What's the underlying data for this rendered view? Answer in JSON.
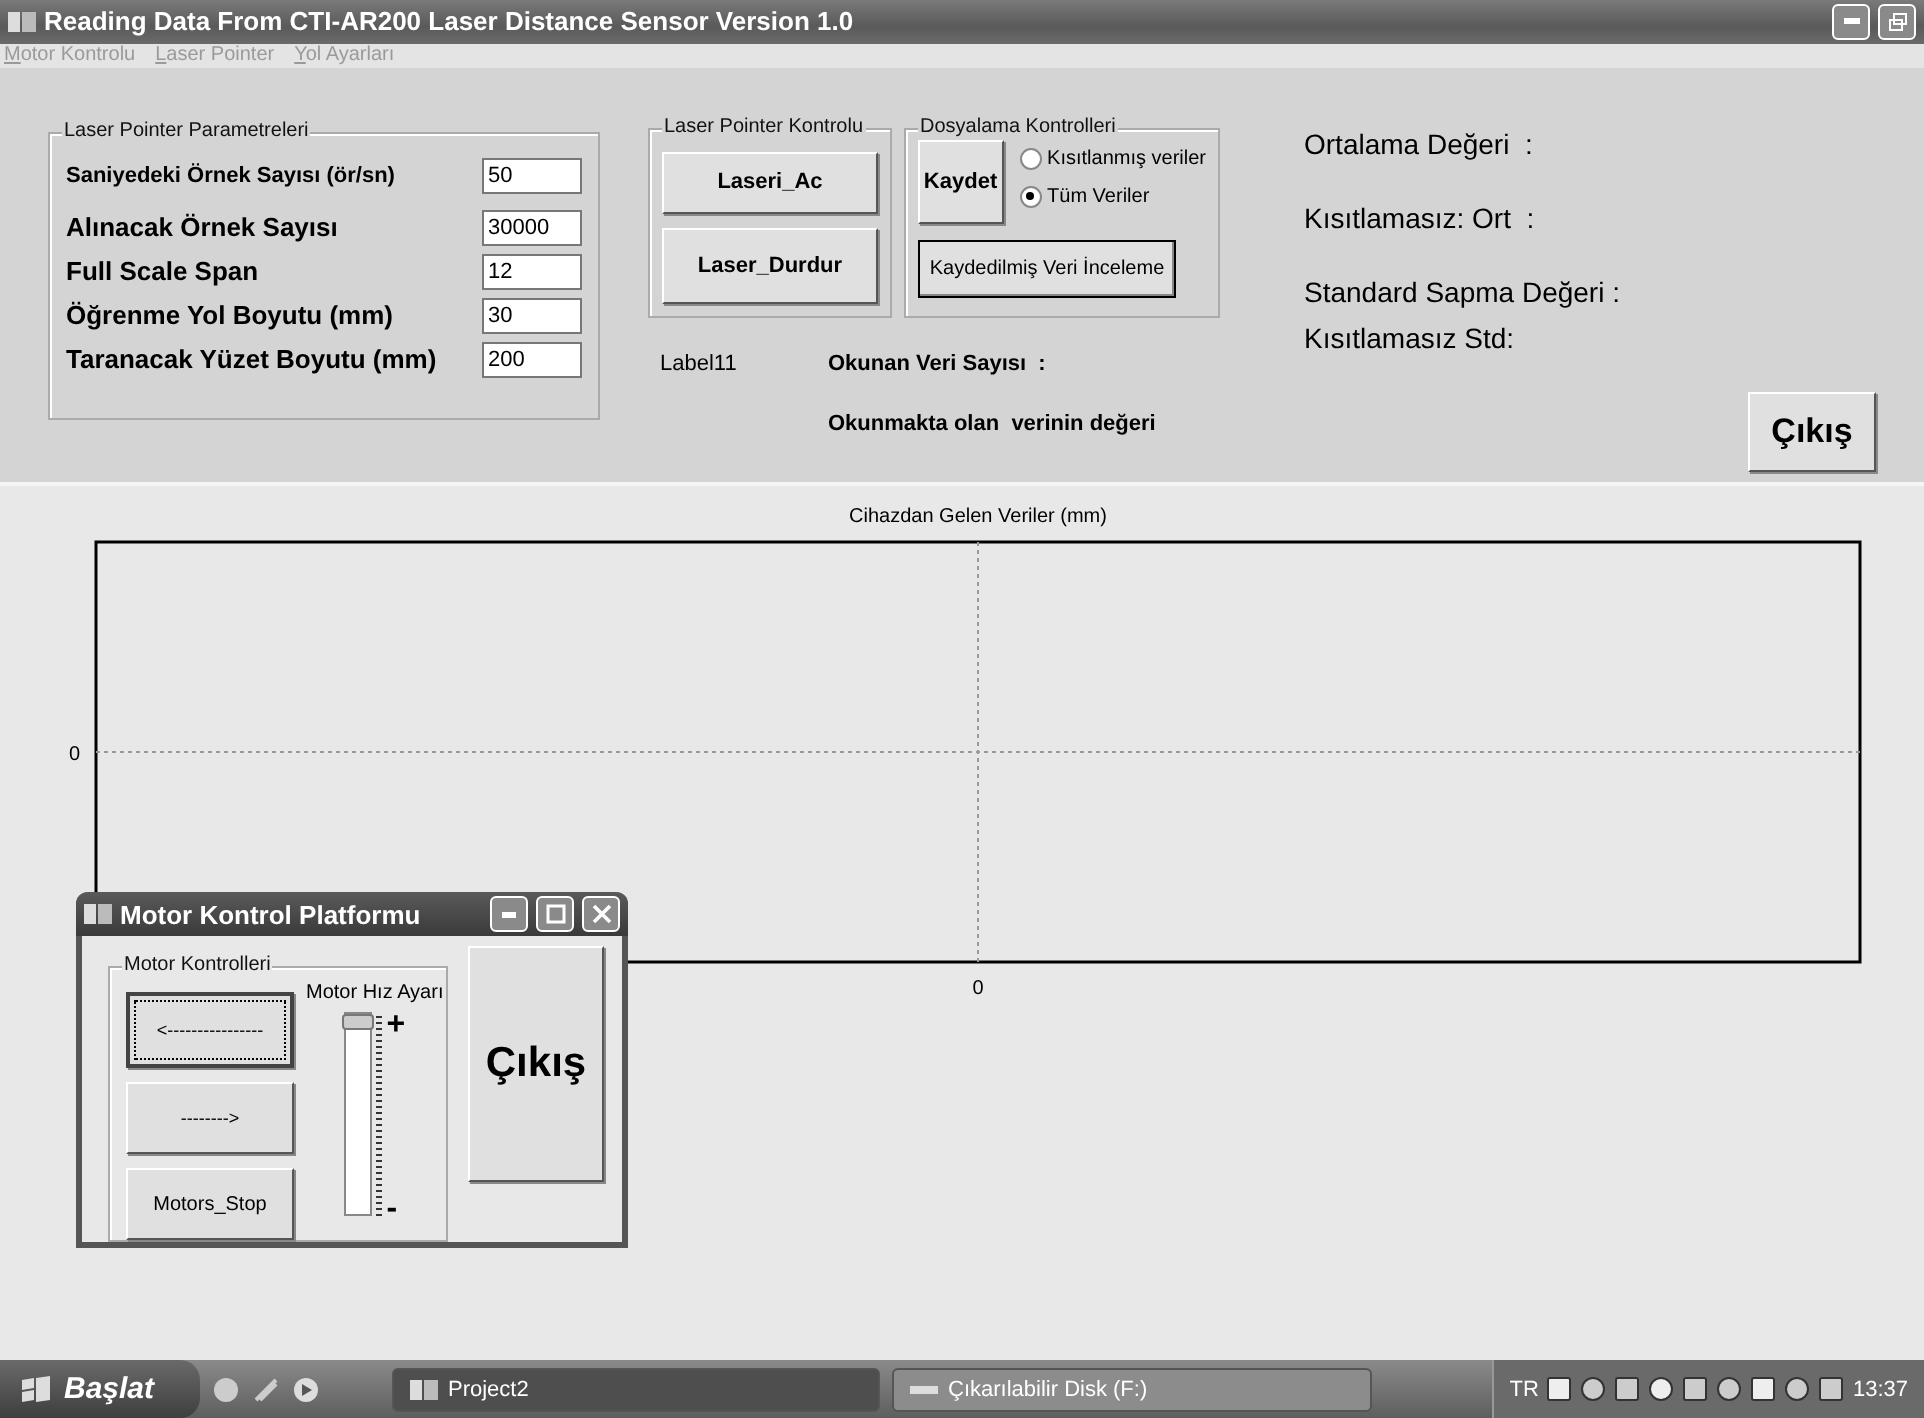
{
  "window": {
    "title": "Reading Data From CTI-AR200 Laser Distance Sensor Version 1.0"
  },
  "menu": [
    {
      "label": "Motor Kontrolu"
    },
    {
      "label": "Laser Pointer"
    },
    {
      "label": "Yol Ayarları"
    }
  ],
  "parameters": {
    "title": "Laser Pointer Parametreleri",
    "fields": [
      {
        "label": "Saniyedeki Örnek Sayısı (ör/sn)",
        "value": "50"
      },
      {
        "label": "Alınacak Örnek Sayısı",
        "value": "30000"
      },
      {
        "label": "Full Scale Span",
        "value": "12"
      },
      {
        "label": "Öğrenme Yol Boyutu (mm)",
        "value": "30"
      },
      {
        "label": "Taranacak Yüzet Boyutu (mm)",
        "value": "200"
      }
    ]
  },
  "laser_control": {
    "title": "Laser Pointer Kontrolu",
    "buttons": [
      "Laseri_Ac",
      "Laser_Durdur"
    ]
  },
  "file_control": {
    "title": "Dosyalama Kontrolleri",
    "save_button": "Kaydet",
    "options": [
      {
        "label": "Kısıtlanmış veriler",
        "selected": false
      },
      {
        "label": "Tüm Veriler",
        "selected": true
      }
    ],
    "review_button": "Kaydedilmiş Veri İnceleme"
  },
  "status": {
    "label": "Label11",
    "count_label": "Okunan Veri Sayısı  :",
    "value_label": "Okunmakta olan  verinin değeri"
  },
  "stats": [
    "Ortalama Değeri  :",
    "Kısıtlamasız: Ort  :",
    "Standard Sapma Değeri :",
    "Kısıtlamasız Std:"
  ],
  "exit_button": "Çıkış",
  "chart": {
    "title": "Cihazdan Gelen Veriler (mm)",
    "x_axis_label": "0",
    "y_axis_label": "0"
  },
  "motor_window": {
    "title": "Motor Kontrol Platformu",
    "group_title": "Motor Kontrolleri",
    "buttons": [
      {
        "label": "<----------------",
        "focused": true
      },
      {
        "label": "-------->",
        "focused": false
      },
      {
        "label": "Motors_Stop",
        "focused": false
      }
    ],
    "speed": {
      "label": "Motor Hız Ayarı",
      "max_label": "+",
      "min_label": "-",
      "level": 1
    },
    "exit_button": "Çıkış"
  },
  "taskbar": {
    "start": "Başlat",
    "tasks": [
      {
        "label": "Project2",
        "selected": true
      },
      {
        "label": "Çıkarılabilir Disk (F:)",
        "selected": false
      }
    ],
    "language": "TR",
    "clock": "13:37"
  }
}
